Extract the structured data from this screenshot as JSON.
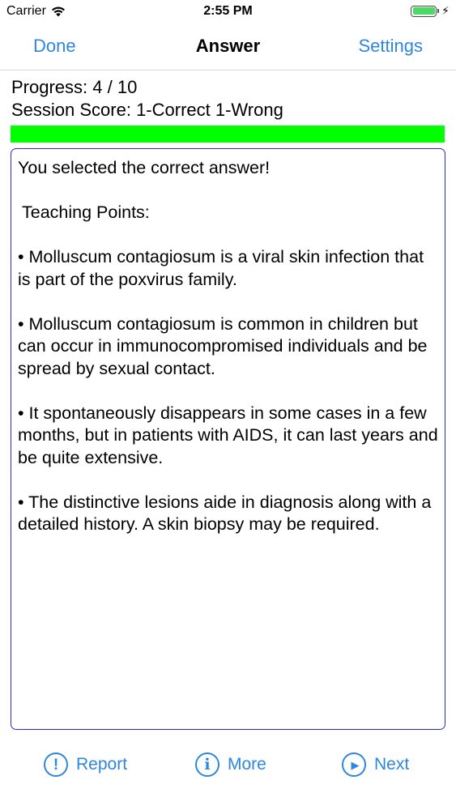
{
  "status_bar": {
    "carrier": "Carrier",
    "time": "2:55 PM",
    "battery_percent": 100
  },
  "nav": {
    "left_label": "Done",
    "title": "Answer",
    "right_label": "Settings"
  },
  "progress": {
    "progress_label": "Progress: 4 / 10",
    "score_label": "Session Score: 1-Correct 1-Wrong",
    "bar_fraction": 1.0,
    "bar_color": "#00ff00"
  },
  "answer": {
    "result": "You selected the correct answer!",
    "heading": "Teaching Points:",
    "points": [
      "• Molluscum contagiosum is a viral skin infection that is part of the poxvirus family.",
      "• Molluscum contagiosum is common in children but can occur in immunocompromised individuals and be spread by sexual contact.",
      "• It spontaneously disappears in some cases in a few months, but in patients with AIDS, it can last years and be quite extensive.",
      "• The distinctive lesions aide in diagnosis along with a detailed history. A skin biopsy may be required."
    ]
  },
  "toolbar": {
    "report_label": "Report",
    "report_icon": "exclamation-circle-icon",
    "report_glyph": "!",
    "more_label": "More",
    "more_icon": "info-circle-icon",
    "more_glyph": "i",
    "next_label": "Next",
    "next_icon": "play-circle-icon",
    "next_glyph": "▶"
  },
  "colors": {
    "accent": "#2e86de",
    "box_border": "#2a2ad0"
  }
}
